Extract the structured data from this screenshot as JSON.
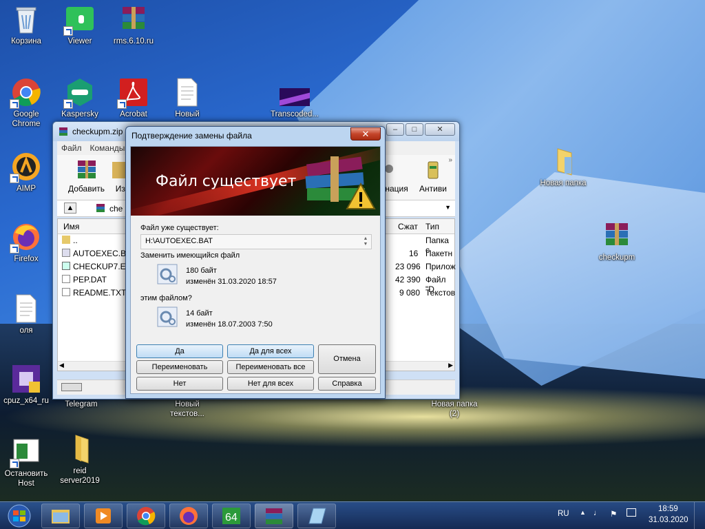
{
  "desktop": {
    "icons": [
      {
        "label": "Корзина"
      },
      {
        "label": "Viewer"
      },
      {
        "label": "rms.6.10.ru"
      },
      {
        "label": "Google Chrome"
      },
      {
        "label": "Kaspersky"
      },
      {
        "label": "Acrobat"
      },
      {
        "label": "Новый"
      },
      {
        "label": "Transcoded..."
      },
      {
        "label": "AIMP"
      },
      {
        "label": "Firefox"
      },
      {
        "label": "оля"
      },
      {
        "label": "cpuz_x64_ru"
      },
      {
        "label": "Telegram"
      },
      {
        "label": "Новый текстов..."
      },
      {
        "label": "Новая папка (2)"
      },
      {
        "label": "Остановить Host"
      },
      {
        "label": "reid server2019"
      },
      {
        "label": "Новая папка"
      },
      {
        "label": "checkupm"
      }
    ]
  },
  "explorer": {
    "title": "checkupm.zip",
    "menu": [
      "Файл",
      "Команды"
    ],
    "toolbar": [
      "Добавить",
      "Изв",
      "нация",
      "Антиви"
    ],
    "address": "che",
    "columns": {
      "name": "Имя",
      "packed": "Сжат",
      "type": "Тип"
    },
    "rows": [
      {
        "name": "..",
        "packed": "",
        "type": "Папка с"
      },
      {
        "name": "AUTOEXEC.BA",
        "packed": "16",
        "type": "Пакетн"
      },
      {
        "name": "CHECKUP7.EX",
        "packed": "23 096",
        "type": "Прилож"
      },
      {
        "name": "PEP.DAT",
        "packed": "42 390",
        "type": "Файл \"D"
      },
      {
        "name": "README.TXT",
        "packed": "9 080",
        "type": "Текстов"
      }
    ]
  },
  "dialog": {
    "title": "Подтверждение замены файла",
    "banner": "Файл существует",
    "exists_label": "Файл уже существует:",
    "path": "H:\\AUTOEXEC.BAT",
    "replace_label": "Заменить имеющийся файл",
    "existing": {
      "size": "180 байт",
      "modified": "изменён 31.03.2020 18:57"
    },
    "with_label": "этим файлом?",
    "new": {
      "size": "14 байт",
      "modified": "изменён 18.07.2003 7:50"
    },
    "buttons": {
      "yes": "Да",
      "yes_all": "Да для всех",
      "rename": "Переименовать",
      "rename_all": "Переименовать все",
      "cancel": "Отмена",
      "no": "Нет",
      "no_all": "Нет для всех",
      "help": "Справка"
    }
  },
  "taskbar": {
    "lang": "RU",
    "time": "18:59",
    "date": "31.03.2020"
  }
}
